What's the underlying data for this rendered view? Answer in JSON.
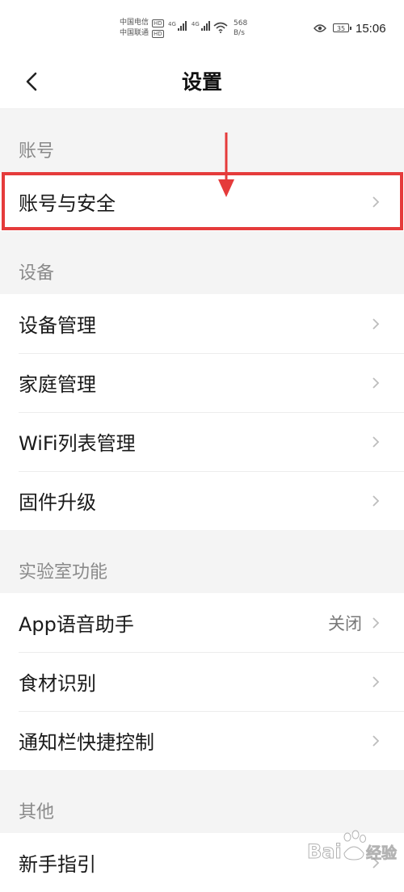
{
  "status_bar": {
    "carrier_1": "中国电信",
    "carrier_2": "中国联通",
    "hd_badge": "HD",
    "network_gen": "4G",
    "net_speed_value": "568",
    "net_speed_unit": "B/s",
    "battery_level": "35",
    "time": "15:06"
  },
  "header": {
    "title": "设置"
  },
  "sections": [
    {
      "title": "账号",
      "items": [
        {
          "label": "账号与安全",
          "value": ""
        }
      ]
    },
    {
      "title": "设备",
      "items": [
        {
          "label": "设备管理",
          "value": ""
        },
        {
          "label": "家庭管理",
          "value": ""
        },
        {
          "label": "WiFi列表管理",
          "value": ""
        },
        {
          "label": "固件升级",
          "value": ""
        }
      ]
    },
    {
      "title": "实验室功能",
      "items": [
        {
          "label": "App语音助手",
          "value": "关闭"
        },
        {
          "label": "食材识别",
          "value": ""
        },
        {
          "label": "通知栏快捷控制",
          "value": ""
        }
      ]
    },
    {
      "title": "其他",
      "items": [
        {
          "label": "新手指引",
          "value": ""
        }
      ]
    }
  ],
  "annotation": {
    "highlight_color": "#e53b3b"
  },
  "watermark": {
    "text": "Bai 经验"
  }
}
